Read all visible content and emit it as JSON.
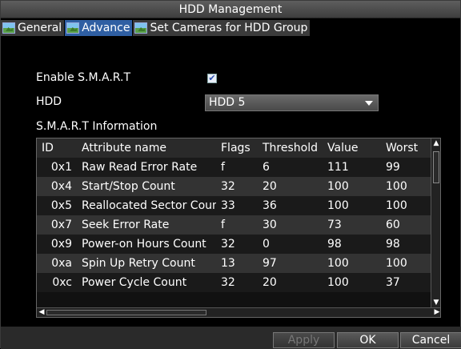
{
  "window": {
    "title": "HDD Management"
  },
  "tabs": [
    {
      "label": "General",
      "icon": "image-icon",
      "active": false
    },
    {
      "label": "Advance",
      "icon": "image-icon",
      "active": true
    },
    {
      "label": "Set Cameras for HDD Group",
      "icon": "image-icon",
      "active": false
    }
  ],
  "smart": {
    "enable_label": "Enable S.M.A.R.T",
    "enabled": true,
    "check_mark": "✔",
    "hdd_label": "HDD",
    "hdd_value": "HDD 5",
    "info_label": "S.M.A.R.T Information"
  },
  "table": {
    "headers": {
      "id": "ID",
      "name": "Attribute name",
      "flags": "Flags",
      "threshold": "Threshold",
      "value": "Value",
      "worst": "Worst"
    },
    "rows": [
      {
        "id": "0x1",
        "name": "Raw Read Error Rate",
        "flags": "f",
        "threshold": "6",
        "value": "111",
        "worst": "99"
      },
      {
        "id": "0x4",
        "name": "Start/Stop Count",
        "flags": "32",
        "threshold": "20",
        "value": "100",
        "worst": "100"
      },
      {
        "id": "0x5",
        "name": "Reallocated Sector Count",
        "flags": "33",
        "threshold": "36",
        "value": "100",
        "worst": "100"
      },
      {
        "id": "0x7",
        "name": "Seek Error Rate",
        "flags": "f",
        "threshold": "30",
        "value": "73",
        "worst": "60"
      },
      {
        "id": "0x9",
        "name": "Power-on Hours Count",
        "flags": "32",
        "threshold": "0",
        "value": "98",
        "worst": "98"
      },
      {
        "id": "0xa",
        "name": "Spin Up Retry Count",
        "flags": "13",
        "threshold": "97",
        "value": "100",
        "worst": "100"
      },
      {
        "id": "0xc",
        "name": "Power Cycle Count",
        "flags": "32",
        "threshold": "20",
        "value": "100",
        "worst": "37"
      }
    ]
  },
  "buttons": {
    "apply": "Apply",
    "ok": "OK",
    "cancel": "Cancel"
  },
  "colors": {
    "active_tab": "#2f5fa3",
    "background": "#000000"
  }
}
